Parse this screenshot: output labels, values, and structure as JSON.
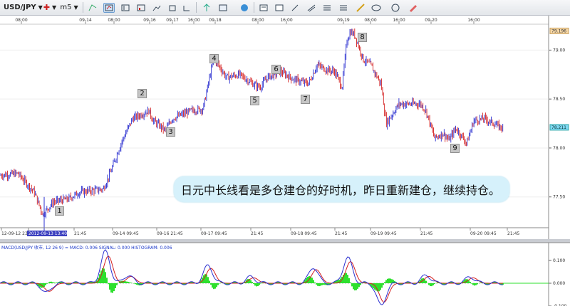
{
  "toolbar": {
    "symbol": "USD/JPY",
    "timeframe": "m5",
    "icons": [
      "chart-type-icon",
      "pin-icon",
      "bar-chart-icon",
      "candle-chart-icon",
      "line-chart-icon",
      "tile-icon",
      "zoom-icon",
      "crosshair-icon",
      "arrow-up-icon",
      "globe-icon",
      "settings-icon",
      "text-icon",
      "magnifier-icon",
      "wand-icon",
      "lines-icon",
      "color-icon",
      "pencil-icon",
      "circle-icon",
      "eraser-icon"
    ]
  },
  "top_scale_labels": [
    "08:00",
    "09-14",
    "08:00",
    "09-16",
    "09-17",
    "16:00",
    "09-18",
    "08:00",
    "16:00",
    "09-19",
    "08:00",
    "16:00",
    "09-20",
    "16:00"
  ],
  "bottom_scale_labels": [
    "12-09-12 23",
    "2012-09-13 13:40",
    "21:45",
    "09-14 09:45",
    "09-16 21:45",
    "09-17 09:45",
    "21:45",
    "09-18 09:45",
    "21:45",
    "09-19 09:45",
    "21:45",
    "09-20 09:45",
    "21:45"
  ],
  "price_axis": {
    "labels": [
      "79.00",
      "78.50",
      "78.00",
      "77.50"
    ],
    "high_tag": "79.196",
    "current_tag": "78.211"
  },
  "macd": {
    "header": "MACD(USD/JPY 收市, 12 26 9) = MACD: 0.006 SIGNAL: 0.000 HISTOGRAM: 0.006",
    "axis_labels": [
      "0.100",
      "0.000",
      "-0.100"
    ]
  },
  "annotation": "日元中长线看是多仓建仓的好时机，昨日重新建仓，继续持仓。",
  "wave_labels": [
    "1",
    "2",
    "3",
    "4",
    "5",
    "6",
    "7",
    "8",
    "9"
  ],
  "chart_data": {
    "type": "line",
    "title": "",
    "xlabel": "",
    "ylabel": "",
    "ylim": [
      77.2,
      79.25
    ],
    "x": [
      "09-13",
      "09-13",
      "09-13",
      "09-14",
      "09-14",
      "09-16",
      "09-16",
      "09-17",
      "09-17",
      "09-17",
      "09-18",
      "09-18",
      "09-18",
      "09-18",
      "09-19",
      "09-19",
      "09-19",
      "09-19",
      "09-19",
      "09-20",
      "09-20",
      "09-20"
    ],
    "series": [
      {
        "values": [
          77.7,
          77.45,
          77.55,
          77.62,
          78.1,
          78.38,
          78.25,
          78.45,
          78.9,
          78.75,
          78.68,
          78.65,
          78.8,
          78.62,
          78.85,
          78.75,
          79.19,
          78.9,
          78.25,
          78.45,
          78.05,
          78.22
        ]
      }
    ],
    "annotations": [
      {
        "label": "1",
        "x": "09-13",
        "y": 77.1
      },
      {
        "label": "2",
        "x": "09-16",
        "y": 78.43
      },
      {
        "label": "3",
        "x": "09-16",
        "y": 78.15
      },
      {
        "label": "4",
        "x": "09-17",
        "y": 78.94
      },
      {
        "label": "5",
        "x": "09-18",
        "y": 78.6
      },
      {
        "label": "6",
        "x": "09-18",
        "y": 78.84
      },
      {
        "label": "7",
        "x": "09-18",
        "y": 78.6
      },
      {
        "label": "8",
        "x": "09-19",
        "y": 79.23
      },
      {
        "label": "9",
        "x": "09-20",
        "y": 78.05
      }
    ]
  }
}
